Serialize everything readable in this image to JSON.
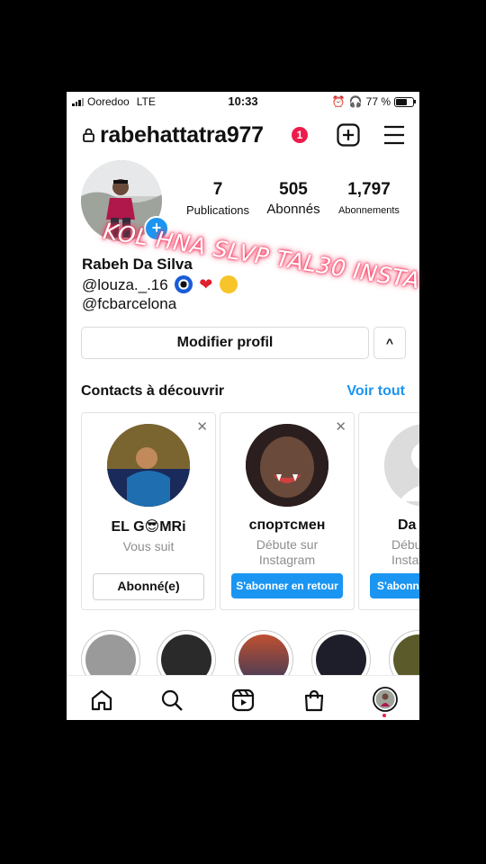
{
  "status": {
    "carrier": "Ooredoo",
    "network": "LTE",
    "time": "10:33",
    "battery": "77 %",
    "battery_level": 0.77
  },
  "header": {
    "username": "rabehattatra977",
    "notifications": "1"
  },
  "stats": [
    {
      "value": "7",
      "label": "Publications"
    },
    {
      "value": "505",
      "label": "Abonnés"
    },
    {
      "value": "1,797",
      "label": "Abonnements"
    }
  ],
  "overlay_text": "KOL HNA SLVP TAL30 INSTA",
  "bio": {
    "name": "Rabeh Da Silva",
    "line1": "@louza._.16",
    "line2": "@fcbarcelona"
  },
  "buttons": {
    "edit_profile": "Modifier profil",
    "collapse": "^"
  },
  "suggestions": {
    "title": "Contacts à découvrir",
    "see_all": "Voir tout",
    "cards": [
      {
        "name": "EL G😎MRi",
        "subtitle": "Vous suit",
        "button": "Abonné(e)"
      },
      {
        "name": "спортсмен",
        "subtitle": "Débute sur Instagram",
        "button": "S'abonner en retour"
      },
      {
        "name": "Da",
        "subtitle": "Débu Insta",
        "button": "S'abonne"
      }
    ]
  },
  "icons": {
    "lock": "lock-icon",
    "add": "plus-square-icon",
    "menu": "hamburger-menu-icon",
    "home": "home-icon",
    "search": "search-icon",
    "reels": "reels-icon",
    "shop": "shop-bag-icon",
    "profile": "profile-avatar-icon"
  },
  "colors": {
    "accent": "#1b95f2",
    "badge": "#ed1c4a"
  }
}
